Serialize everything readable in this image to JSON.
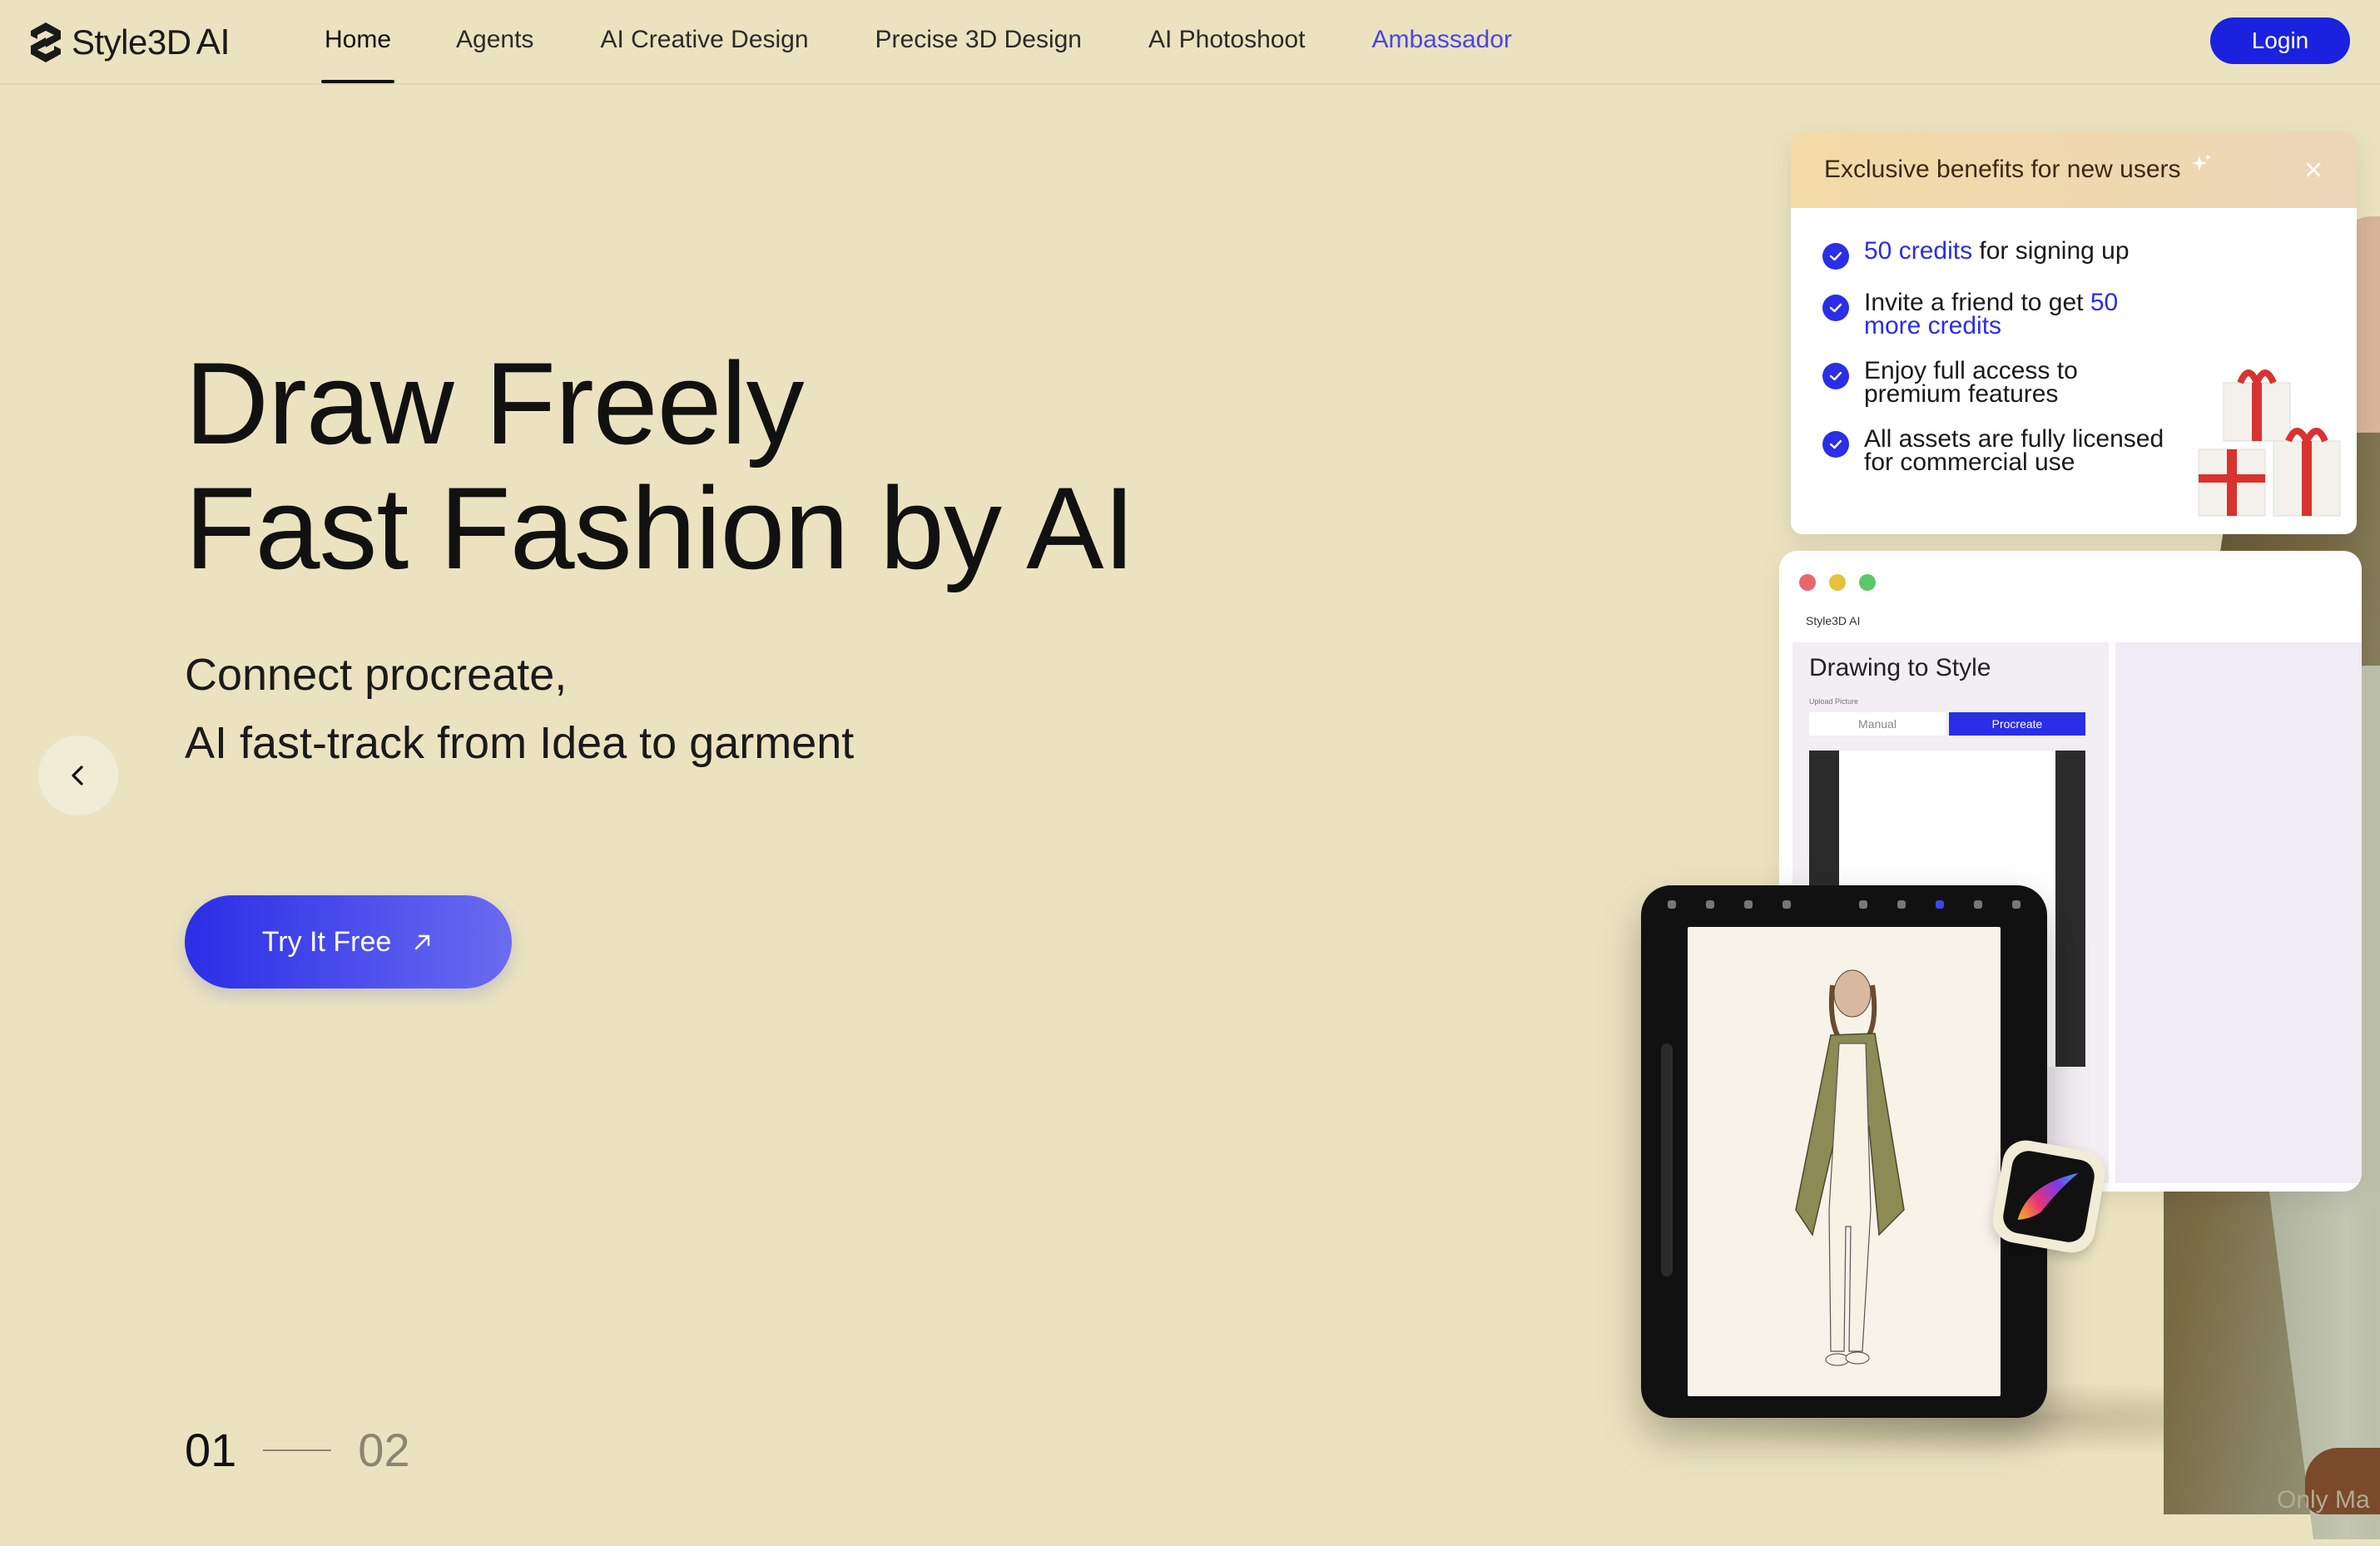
{
  "brand": {
    "name": "Style3D",
    "suffix": "AI"
  },
  "nav": [
    {
      "label": "Home"
    },
    {
      "label": "Agents"
    },
    {
      "label": "AI Creative Design"
    },
    {
      "label": "Precise 3D Design"
    },
    {
      "label": "AI Photoshoot"
    },
    {
      "label": "Ambassador"
    }
  ],
  "login_label": "Login",
  "hero": {
    "title_line1": "Draw Freely",
    "title_line2": "Fast Fashion by AI",
    "subtitle_line1": "Connect procreate,",
    "subtitle_line2": "AI fast-track from Idea to garment",
    "cta_label": "Try It Free"
  },
  "pager": {
    "current": "01",
    "next": "02"
  },
  "benefits": {
    "title": "Exclusive benefits for new users",
    "items": [
      {
        "highlight": "50 credits",
        "text": " for signing up"
      },
      {
        "text": "Invite a friend to get ",
        "highlight": "50 more credits"
      },
      {
        "text": "Enjoy full access to premium features"
      },
      {
        "text": "All assets are fully licensed for commercial use"
      }
    ]
  },
  "app_mock": {
    "logo": "Style3D AI",
    "heading": "Drawing to Style",
    "small_label": "Upload Picture",
    "tab_manual": "Manual",
    "tab_procreate": "Procreate"
  },
  "footer_hint": "Only Ma",
  "colors": {
    "background": "#ebe3bf",
    "accent": "#2a2ee6",
    "ambassador": "#4a45e6",
    "popup_header": "#f2dba6"
  },
  "icons": [
    "logo-mark-icon",
    "arrow-up-right-icon",
    "chevron-left-icon",
    "chevron-right-icon",
    "close-icon",
    "sparkle-icon",
    "check-icon",
    "gift-icon",
    "procreate-app-icon"
  ]
}
